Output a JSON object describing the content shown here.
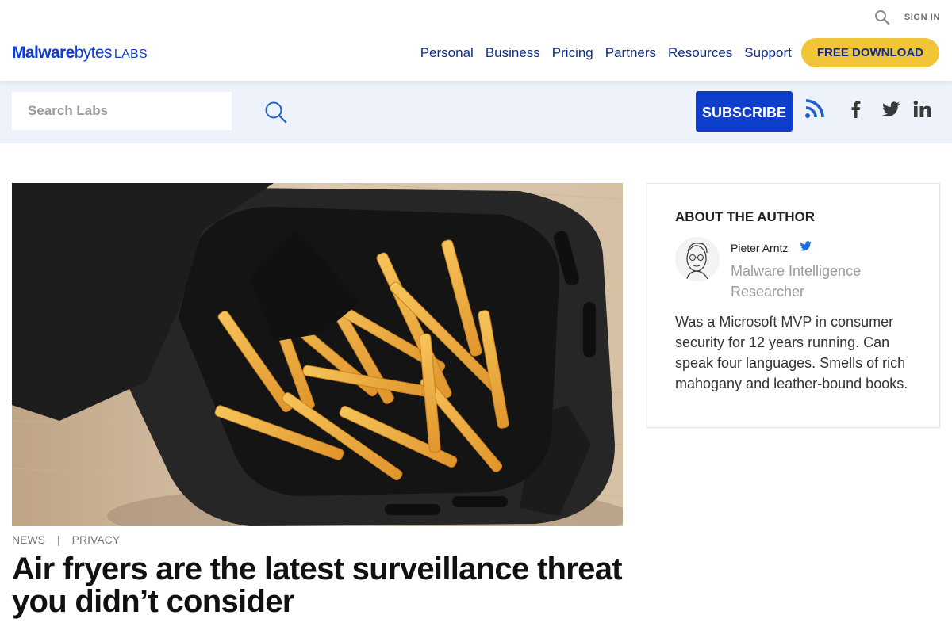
{
  "header": {
    "sign_in": "SIGN IN",
    "logo": {
      "part1": "Malware",
      "part2": "bytes",
      "suffix": "LABS"
    },
    "nav": [
      "Personal",
      "Business",
      "Pricing",
      "Partners",
      "Resources",
      "Support"
    ],
    "download": "FREE DOWNLOAD"
  },
  "search": {
    "placeholder": "Search Labs"
  },
  "subscribe": "SUBSCRIBE",
  "social_icons": [
    "rss-icon",
    "facebook-icon",
    "twitter-icon",
    "linkedin-icon"
  ],
  "article": {
    "categories": [
      "NEWS",
      "PRIVACY"
    ],
    "separator": "|",
    "title": "Air fryers are the latest surveillance threat you didn’t consider"
  },
  "author": {
    "heading": "ABOUT THE AUTHOR",
    "name": "Pieter Arntz",
    "role": "Malware Intelligence Researcher",
    "bio": "Was a Microsoft MVP in consumer security for 12 years running. Can speak four languages. Smells of rich mahogany and leather-bound books."
  },
  "colors": {
    "brand_blue": "#0d3ecc",
    "nav_blue": "#0b2d8c",
    "download_yellow": "#f0c538",
    "band_bg": "#eef3fb"
  }
}
